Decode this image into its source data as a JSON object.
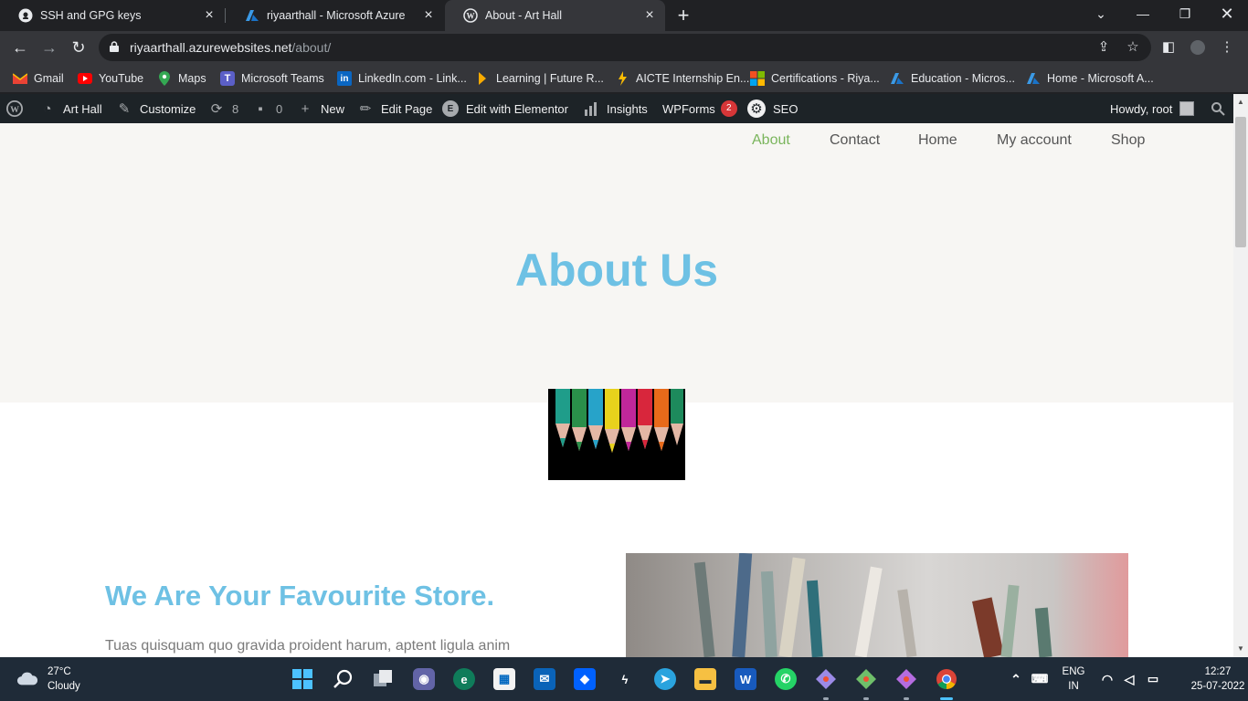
{
  "browser": {
    "tabs": [
      {
        "title": "SSH and GPG keys",
        "icon": "github-icon"
      },
      {
        "title": "riyaarthall - Microsoft Azure",
        "icon": "azure-icon"
      },
      {
        "title": "About - Art Hall",
        "icon": "wordpress-icon",
        "active": true
      }
    ],
    "url_host": "riyaarthall.azurewebsites.net",
    "url_path": "/about/"
  },
  "bookmarks": [
    {
      "label": "Gmail",
      "icon": "gmail-icon"
    },
    {
      "label": "YouTube",
      "icon": "youtube-icon"
    },
    {
      "label": "Maps",
      "icon": "maps-icon"
    },
    {
      "label": "Microsoft Teams",
      "icon": "teams-icon"
    },
    {
      "label": "LinkedIn.com - Link...",
      "icon": "linkedin-icon"
    },
    {
      "label": "Learning | Future R...",
      "icon": "futureskills-icon"
    },
    {
      "label": "AICTE Internship En...",
      "icon": "aicte-icon"
    },
    {
      "label": "Certifications - Riya...",
      "icon": "microsoft-icon"
    },
    {
      "label": "Education - Micros...",
      "icon": "azure-icon"
    },
    {
      "label": "Home - Microsoft A...",
      "icon": "azure-icon"
    }
  ],
  "adminbar": {
    "site_name": "Art Hall",
    "customize": "Customize",
    "updates_count": "8",
    "comments_count": "0",
    "new_label": "New",
    "edit_page": "Edit Page",
    "edit_elementor": "Edit with Elementor",
    "insights": "Insights",
    "wpforms": "WPForms",
    "wpforms_badge": "2",
    "seo": "SEO",
    "howdy": "Howdy, root"
  },
  "site": {
    "nav": [
      "About",
      "Contact",
      "Home",
      "My account",
      "Shop"
    ],
    "nav_active": "About",
    "hero_title": "About Us",
    "section_title": "We Are Your Favourite Store.",
    "section_text": "Tuas quisquam quo gravida proident harum, aptent ligula anim"
  },
  "colors": {
    "accent_blue": "#6ec1e4",
    "nav_active_green": "#7ab55c",
    "hero_bg": "#f7f6f3",
    "adminbar_bg": "#1d2327"
  },
  "taskbar": {
    "weather_temp": "27°C",
    "weather_cond": "Cloudy",
    "lang_top": "ENG",
    "lang_bottom": "IN",
    "time": "12:27",
    "date": "25-07-2022"
  }
}
